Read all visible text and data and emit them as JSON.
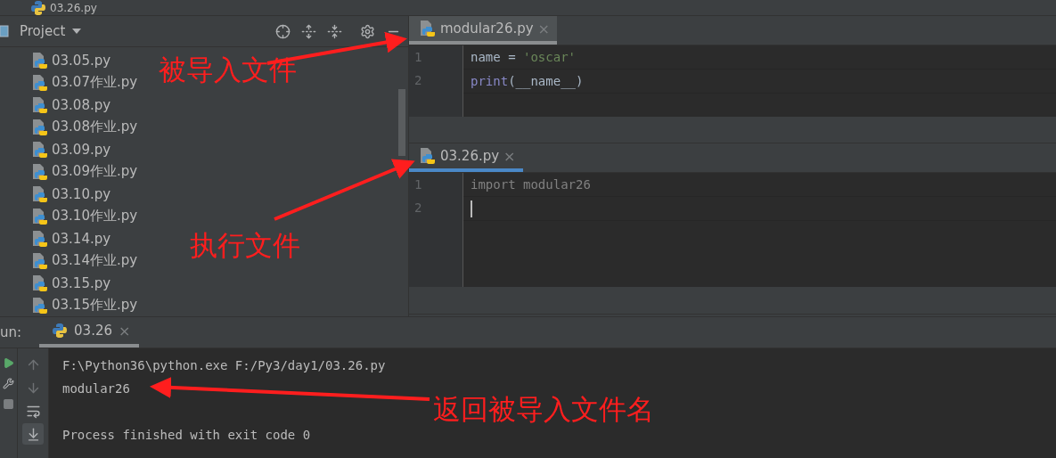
{
  "breadcrumb": {
    "path": "03.26.py"
  },
  "project": {
    "title": "Project",
    "files": [
      "03.05.py",
      "03.07作业.py",
      "03.08.py",
      "03.08作业.py",
      "03.09.py",
      "03.09作业.py",
      "03.10.py",
      "03.10作业.py",
      "03.14.py",
      "03.14作业.py",
      "03.15.py",
      "03.15作业.py"
    ]
  },
  "editors": [
    {
      "tab": {
        "label": "modular26.py",
        "close": "×",
        "selected": false
      },
      "lines": [
        {
          "number": "1",
          "caret": false,
          "tokens": [
            {
              "kind": "plain",
              "text": "name = "
            },
            {
              "kind": "string",
              "text": "'oscar'"
            }
          ]
        },
        {
          "number": "2",
          "caret": false,
          "tokens": [
            {
              "kind": "builtin",
              "text": "print"
            },
            {
              "kind": "plain",
              "text": "(__name__)"
            }
          ]
        }
      ]
    },
    {
      "tab": {
        "label": "03.26.py",
        "close": "×",
        "selected": true
      },
      "lines": [
        {
          "number": "1",
          "caret": false,
          "tokens": [
            {
              "kind": "unused",
              "text": "import modular26"
            }
          ]
        },
        {
          "number": "2",
          "caret": true
        }
      ]
    }
  ],
  "run": {
    "label": "un:",
    "tab": {
      "label": "03.26",
      "close": "×"
    },
    "output": [
      {
        "text": "F:\\Python36\\python.exe F:/Py3/day1/03.26.py",
        "gap_before": false
      },
      {
        "text": "modular26",
        "gap_before": false
      },
      {
        "text": "Process finished with exit code 0",
        "gap_before": true
      }
    ]
  },
  "annotations": [
    {
      "text": "被导入文件"
    },
    {
      "text": "执行文件"
    },
    {
      "text": "返回被导入文件名"
    }
  ]
}
